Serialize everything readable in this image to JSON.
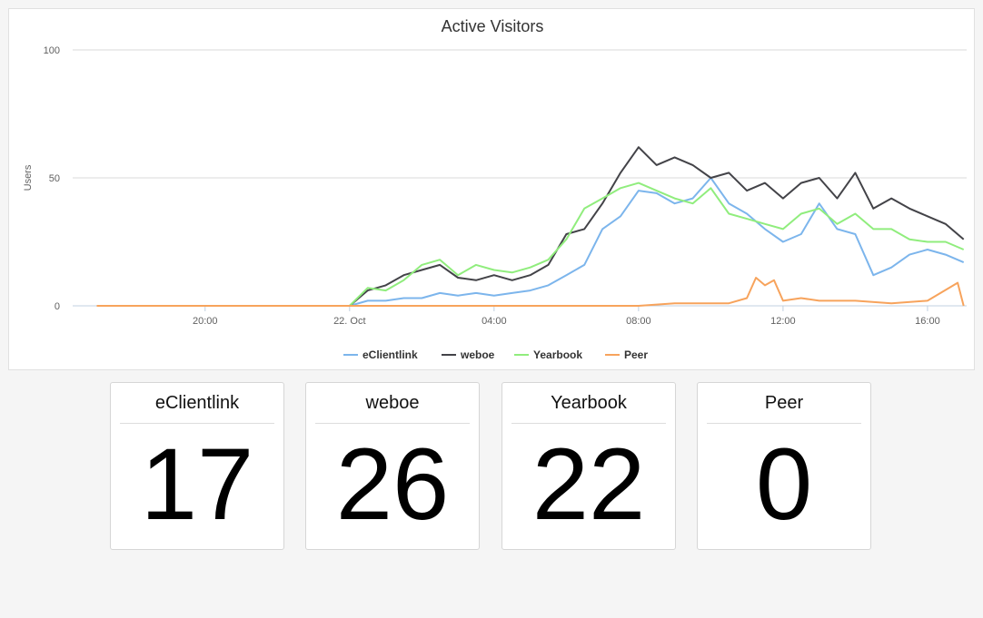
{
  "chart_data": {
    "type": "line",
    "title": "Active Visitors",
    "ylabel": "Users",
    "xlabel": "",
    "ylim": [
      0,
      100
    ],
    "yticks": [
      0,
      50,
      100
    ],
    "xlim": [
      "21 Oct 16:20",
      "22 Oct 17:05"
    ],
    "xticks": [
      "20:00",
      "22. Oct",
      "04:00",
      "08:00",
      "12:00",
      "16:00"
    ],
    "grid": true,
    "legend": "bottom-center",
    "series": [
      {
        "name": "eClientlink",
        "color": "#7cb5ec",
        "points": [
          [
            "21 Oct 17:00",
            0
          ],
          [
            "22 Oct 00:00",
            0
          ],
          [
            "22 Oct 00:30",
            2
          ],
          [
            "22 Oct 01:00",
            2
          ],
          [
            "22 Oct 01:30",
            3
          ],
          [
            "22 Oct 02:00",
            3
          ],
          [
            "22 Oct 02:30",
            5
          ],
          [
            "22 Oct 03:00",
            4
          ],
          [
            "22 Oct 03:30",
            5
          ],
          [
            "22 Oct 04:00",
            4
          ],
          [
            "22 Oct 04:30",
            5
          ],
          [
            "22 Oct 05:00",
            6
          ],
          [
            "22 Oct 05:30",
            8
          ],
          [
            "22 Oct 06:00",
            12
          ],
          [
            "22 Oct 06:30",
            16
          ],
          [
            "22 Oct 07:00",
            30
          ],
          [
            "22 Oct 07:30",
            35
          ],
          [
            "22 Oct 08:00",
            45
          ],
          [
            "22 Oct 08:30",
            44
          ],
          [
            "22 Oct 09:00",
            40
          ],
          [
            "22 Oct 09:30",
            42
          ],
          [
            "22 Oct 10:00",
            50
          ],
          [
            "22 Oct 10:30",
            40
          ],
          [
            "22 Oct 11:00",
            36
          ],
          [
            "22 Oct 11:30",
            30
          ],
          [
            "22 Oct 12:00",
            25
          ],
          [
            "22 Oct 12:30",
            28
          ],
          [
            "22 Oct 13:00",
            40
          ],
          [
            "22 Oct 13:30",
            30
          ],
          [
            "22 Oct 14:00",
            28
          ],
          [
            "22 Oct 14:30",
            12
          ],
          [
            "22 Oct 15:00",
            15
          ],
          [
            "22 Oct 15:30",
            20
          ],
          [
            "22 Oct 16:00",
            22
          ],
          [
            "22 Oct 16:30",
            20
          ],
          [
            "22 Oct 17:00",
            17
          ]
        ]
      },
      {
        "name": "weboe",
        "color": "#434348",
        "points": [
          [
            "21 Oct 17:00",
            0
          ],
          [
            "22 Oct 00:00",
            0
          ],
          [
            "22 Oct 00:30",
            6
          ],
          [
            "22 Oct 01:00",
            8
          ],
          [
            "22 Oct 01:30",
            12
          ],
          [
            "22 Oct 02:00",
            14
          ],
          [
            "22 Oct 02:30",
            16
          ],
          [
            "22 Oct 03:00",
            11
          ],
          [
            "22 Oct 03:30",
            10
          ],
          [
            "22 Oct 04:00",
            12
          ],
          [
            "22 Oct 04:30",
            10
          ],
          [
            "22 Oct 05:00",
            12
          ],
          [
            "22 Oct 05:30",
            16
          ],
          [
            "22 Oct 06:00",
            28
          ],
          [
            "22 Oct 06:30",
            30
          ],
          [
            "22 Oct 07:00",
            40
          ],
          [
            "22 Oct 07:30",
            52
          ],
          [
            "22 Oct 08:00",
            62
          ],
          [
            "22 Oct 08:30",
            55
          ],
          [
            "22 Oct 09:00",
            58
          ],
          [
            "22 Oct 09:30",
            55
          ],
          [
            "22 Oct 10:00",
            50
          ],
          [
            "22 Oct 10:30",
            52
          ],
          [
            "22 Oct 11:00",
            45
          ],
          [
            "22 Oct 11:30",
            48
          ],
          [
            "22 Oct 12:00",
            42
          ],
          [
            "22 Oct 12:30",
            48
          ],
          [
            "22 Oct 13:00",
            50
          ],
          [
            "22 Oct 13:30",
            42
          ],
          [
            "22 Oct 14:00",
            52
          ],
          [
            "22 Oct 14:30",
            38
          ],
          [
            "22 Oct 15:00",
            42
          ],
          [
            "22 Oct 15:30",
            38
          ],
          [
            "22 Oct 16:00",
            35
          ],
          [
            "22 Oct 16:30",
            32
          ],
          [
            "22 Oct 17:00",
            26
          ]
        ]
      },
      {
        "name": "Yearbook",
        "color": "#90ed7d",
        "points": [
          [
            "21 Oct 17:00",
            0
          ],
          [
            "22 Oct 00:00",
            0
          ],
          [
            "22 Oct 00:30",
            7
          ],
          [
            "22 Oct 01:00",
            6
          ],
          [
            "22 Oct 01:30",
            10
          ],
          [
            "22 Oct 02:00",
            16
          ],
          [
            "22 Oct 02:30",
            18
          ],
          [
            "22 Oct 03:00",
            12
          ],
          [
            "22 Oct 03:30",
            16
          ],
          [
            "22 Oct 04:00",
            14
          ],
          [
            "22 Oct 04:30",
            13
          ],
          [
            "22 Oct 05:00",
            15
          ],
          [
            "22 Oct 05:30",
            18
          ],
          [
            "22 Oct 06:00",
            26
          ],
          [
            "22 Oct 06:30",
            38
          ],
          [
            "22 Oct 07:00",
            42
          ],
          [
            "22 Oct 07:30",
            46
          ],
          [
            "22 Oct 08:00",
            48
          ],
          [
            "22 Oct 08:30",
            45
          ],
          [
            "22 Oct 09:00",
            42
          ],
          [
            "22 Oct 09:30",
            40
          ],
          [
            "22 Oct 10:00",
            46
          ],
          [
            "22 Oct 10:30",
            36
          ],
          [
            "22 Oct 11:00",
            34
          ],
          [
            "22 Oct 11:30",
            32
          ],
          [
            "22 Oct 12:00",
            30
          ],
          [
            "22 Oct 12:30",
            36
          ],
          [
            "22 Oct 13:00",
            38
          ],
          [
            "22 Oct 13:30",
            32
          ],
          [
            "22 Oct 14:00",
            36
          ],
          [
            "22 Oct 14:30",
            30
          ],
          [
            "22 Oct 15:00",
            30
          ],
          [
            "22 Oct 15:30",
            26
          ],
          [
            "22 Oct 16:00",
            25
          ],
          [
            "22 Oct 16:30",
            25
          ],
          [
            "22 Oct 17:00",
            22
          ]
        ]
      },
      {
        "name": "Peer",
        "color": "#f7a35c",
        "points": [
          [
            "21 Oct 17:00",
            0
          ],
          [
            "22 Oct 08:00",
            0
          ],
          [
            "22 Oct 09:00",
            1
          ],
          [
            "22 Oct 10:00",
            1
          ],
          [
            "22 Oct 10:30",
            1
          ],
          [
            "22 Oct 11:00",
            3
          ],
          [
            "22 Oct 11:15",
            11
          ],
          [
            "22 Oct 11:30",
            8
          ],
          [
            "22 Oct 11:45",
            10
          ],
          [
            "22 Oct 12:00",
            2
          ],
          [
            "22 Oct 12:30",
            3
          ],
          [
            "22 Oct 13:00",
            2
          ],
          [
            "22 Oct 14:00",
            2
          ],
          [
            "22 Oct 15:00",
            1
          ],
          [
            "22 Oct 16:00",
            2
          ],
          [
            "22 Oct 16:50",
            9
          ],
          [
            "22 Oct 17:00",
            0
          ]
        ]
      }
    ]
  },
  "cards": [
    {
      "title": "eClientlink",
      "value": "17"
    },
    {
      "title": "weboe",
      "value": "26"
    },
    {
      "title": "Yearbook",
      "value": "22"
    },
    {
      "title": "Peer",
      "value": "0"
    }
  ]
}
